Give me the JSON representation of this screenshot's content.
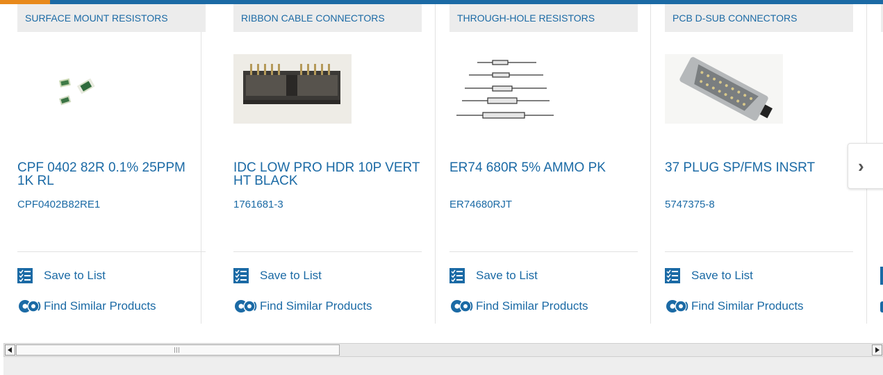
{
  "colors": {
    "brand_blue": "#1b6aa5",
    "accent_orange": "#e8891b",
    "category_bg": "#ececec"
  },
  "cards": [
    {
      "category": "SURFACE MOUNT RESISTORS",
      "product_name": "CPF 0402 82R 0.1% 25PPM 1K RL",
      "part_number": "CPF0402B82RE1",
      "image": "smd-resistor-chips",
      "save_label": "Save to List",
      "find_label": "Find Similar Products"
    },
    {
      "category": "RIBBON CABLE CONNECTORS",
      "product_name": "IDC LOW PRO HDR 10P VERT HT BLACK",
      "part_number": "1761681-3",
      "image": "idc-header-connector",
      "save_label": "Save to List",
      "find_label": "Find Similar Products"
    },
    {
      "category": "THROUGH-HOLE RESISTORS",
      "product_name": "ER74 680R 5% AMMO PK",
      "part_number": "ER74680RJT",
      "image": "axial-resistors",
      "save_label": "Save to List",
      "find_label": "Find Similar Products"
    },
    {
      "category": "PCB D-SUB CONNECTORS",
      "product_name": "37 PLUG SP/FMS INSRT",
      "part_number": "5747375-8",
      "image": "dsub-connector",
      "save_label": "Save to List",
      "find_label": "Find Similar Products"
    }
  ],
  "icons": {
    "save": "checklist-icon",
    "find": "gears-icon",
    "next": "chevron-right-icon"
  },
  "next_glyph": "›"
}
